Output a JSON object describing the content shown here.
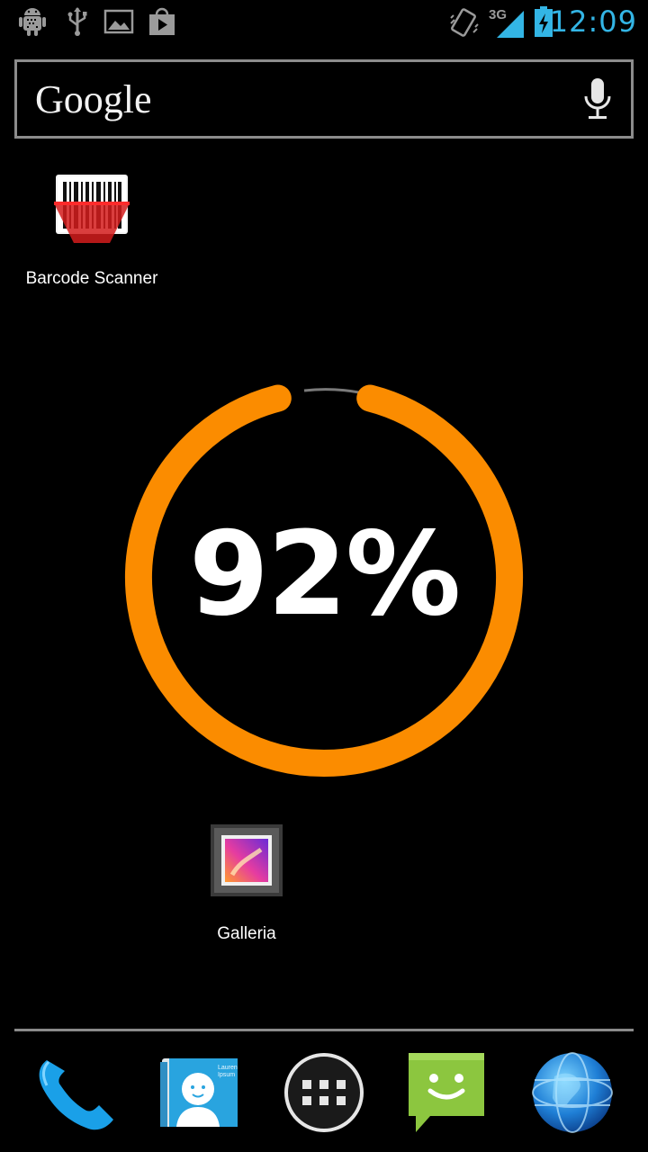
{
  "status_bar": {
    "time": "12:09",
    "network_type": "3G",
    "left_icons": [
      "android-debug-icon",
      "usb-icon",
      "image-icon",
      "play-store-icon"
    ],
    "right_icons": [
      "vibrate-icon",
      "signal-3g-icon",
      "battery-charging-icon"
    ],
    "accent_color": "#33b5e5"
  },
  "search": {
    "logo_text": "Google",
    "mic_icon": "microphone-icon"
  },
  "home_apps": [
    {
      "label": "Barcode Scanner",
      "icon": "barcode-icon"
    },
    {
      "label": "Galleria",
      "icon": "gallery-icon"
    }
  ],
  "battery_widget": {
    "percent_text": "92%",
    "level": 0.92,
    "ring_color": "#fb8c00",
    "track_color": "#7a7a7a"
  },
  "dock": {
    "items": [
      {
        "icon": "phone-icon"
      },
      {
        "icon": "contacts-icon",
        "card_text": "Lauren Ipsum"
      },
      {
        "icon": "app-drawer-icon"
      },
      {
        "icon": "messaging-icon"
      },
      {
        "icon": "browser-globe-icon"
      }
    ]
  }
}
